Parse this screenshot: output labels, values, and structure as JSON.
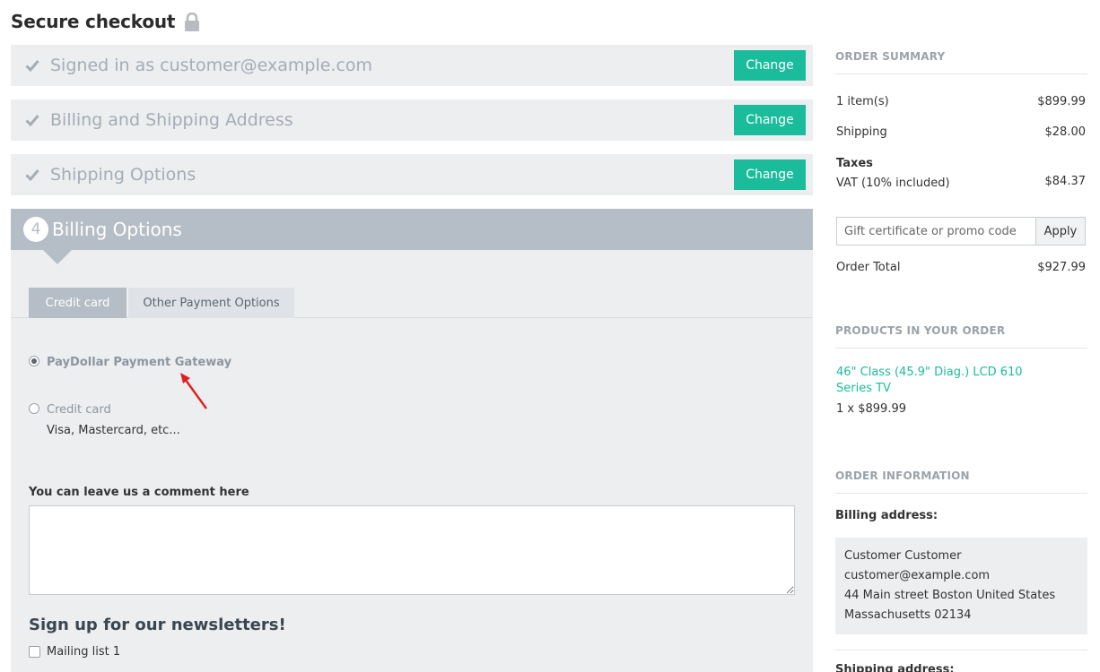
{
  "header": {
    "title": "Secure checkout",
    "icon": "lock-icon"
  },
  "steps": [
    {
      "title": "Signed in as customer@example.com",
      "button": "Change"
    },
    {
      "title": "Billing and Shipping Address",
      "button": "Change"
    },
    {
      "title": "Shipping Options",
      "button": "Change"
    }
  ],
  "billing": {
    "number": "4",
    "title": "Billing Options",
    "tabs": [
      {
        "label": "Credit card",
        "active": true
      },
      {
        "label": "Other Payment Options",
        "active": false
      }
    ],
    "options": [
      {
        "label": "PayDollar Payment Gateway",
        "selected": true
      },
      {
        "label": "Credit card",
        "selected": false,
        "sub": "Visa, Mastercard, etc..."
      }
    ],
    "comment_label": "You can leave us a comment here",
    "newsletter_title": "Sign up for our newsletters!",
    "mailing_list": "Mailing list 1"
  },
  "summary": {
    "title": "ORDER SUMMARY",
    "items_label": "1 item(s)",
    "items_value": "$899.99",
    "shipping_label": "Shipping",
    "shipping_value": "$28.00",
    "taxes_label": "Taxes",
    "vat_label": "VAT (10% included)",
    "vat_value": "$84.37",
    "promo_placeholder": "Gift certificate or promo code",
    "apply_label": "Apply",
    "total_label": "Order Total",
    "total_value": "$927.99"
  },
  "products": {
    "title": "PRODUCTS IN YOUR ORDER",
    "items": [
      {
        "name": "46\" Class (45.9\" Diag.) LCD 610 Series TV",
        "qty_price": "1 x $899.99"
      }
    ]
  },
  "order_info": {
    "title": "ORDER INFORMATION",
    "billing_label": "Billing address:",
    "billing_lines": [
      "Customer  Customer",
      "customer@example.com",
      "44 Main street  Boston  United States",
      "Massachusetts  02134"
    ],
    "shipping_label": "Shipping address:"
  },
  "colors": {
    "accent": "#1abc9c",
    "panel": "#edeef0",
    "header_gray": "#b5bec7",
    "annotation_arrow": "#e02020"
  }
}
